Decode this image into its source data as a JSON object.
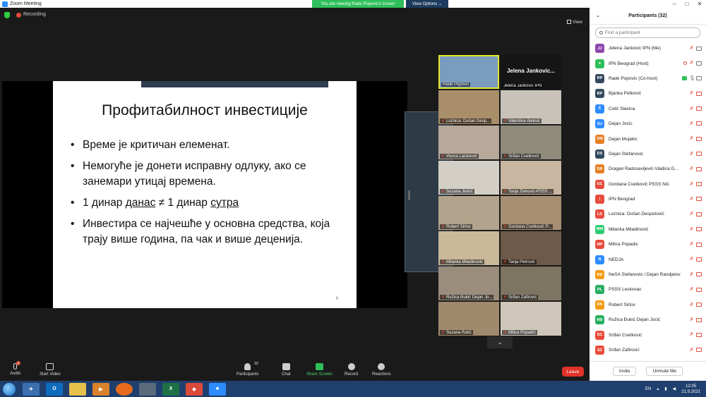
{
  "window": {
    "title": "Zoom Meeting"
  },
  "topbar": {
    "recording_label": "Recording",
    "viewing_banner": "You are viewing Rade Popovic's screen",
    "view_options": "View Options ⌄",
    "view_button": "View"
  },
  "slide": {
    "title": "Профитабилност инвестиције",
    "bullet1": "Време је критичан елеменат.",
    "bullet2": "Немогуће је донети исправну одлуку, ако се занемари утицај времена.",
    "bullet3_a": "1 динар ",
    "bullet3_u1": "данас",
    "bullet3_b": " ≠ 1 динар ",
    "bullet3_u2": "сутра",
    "bullet4": "Инвестира се најчешће у основна средства, која трају више година, па чак и више деценија.",
    "page_number": "9"
  },
  "gallery": {
    "tiles": [
      {
        "name": "Rade Popovic",
        "color": "#7a9cbf"
      },
      {
        "name": "Jelena Jankovic IPN",
        "big": "Jelena Jankovic...",
        "color": "#151515"
      },
      {
        "name": "Loznica: Dušan Desp...",
        "color": "#a98e6a"
      },
      {
        "name": "Valentina Aleksić",
        "color": "#c8c2b8"
      },
      {
        "name": "Vesna Lazarević",
        "color": "#b7a89a"
      },
      {
        "name": "Srđan Cvetković",
        "color": "#8f8a7a"
      },
      {
        "name": "Suzana Jerkić",
        "color": "#d4cfc6"
      },
      {
        "name": "Tanja Živković-PSSS ...",
        "color": "#c9b6a0"
      },
      {
        "name": "Robert Sirtov",
        "color": "#b3a38c"
      },
      {
        "name": "Gordana Cvetković P...",
        "color": "#a88f73"
      },
      {
        "name": "Milanka Miladinović",
        "color": "#c9b89a"
      },
      {
        "name": "Tanja Petrović",
        "color": "#6e5a48"
      },
      {
        "name": "Ružica Đukić Dejan Jo...",
        "color": "#9a8d7c"
      },
      {
        "name": "Srđan Zafirović",
        "color": "#7d7462"
      },
      {
        "name": "Suzana Ratić",
        "color": "#a0896d"
      },
      {
        "name": "Milica Popadić",
        "color": "#cfc7ba"
      }
    ],
    "more": "⌄"
  },
  "participants": {
    "header": "Participants (32)",
    "collapse": "⌄",
    "search_placeholder": "Find a participant",
    "list": [
      {
        "initials": "JJ",
        "name": "Jelena Jankovic IPN (Me)",
        "color": "#8e44ad"
      },
      {
        "initials": "●",
        "name": "IPN Beograd (Host)",
        "color": "#2fbf5a"
      },
      {
        "initials": "RP",
        "name": "Rade Popovic (Co-host)",
        "color": "#34495e"
      },
      {
        "initials": "BP",
        "name": "Bjanka Petković",
        "color": "#34495e"
      },
      {
        "initials": "Č",
        "name": "Čolić Slavica",
        "color": "#2d8cff"
      },
      {
        "initials": "DJ",
        "name": "Dejan Jocic",
        "color": "#2d8cff"
      },
      {
        "initials": "DM",
        "name": "Dejan Mujakic",
        "color": "#e67e22"
      },
      {
        "initials": "DS",
        "name": "Dejan Stefanovic",
        "color": "#34495e"
      },
      {
        "initials": "DR",
        "name": "Dragan Radosavljević-Vladica G...",
        "color": "#e67e22"
      },
      {
        "initials": "GC",
        "name": "Gordana Cvetković PSSS Niš",
        "color": "#e74c3c"
      },
      {
        "initials": "!",
        "name": "IPN Beograd",
        "color": "#e74c3c"
      },
      {
        "initials": "LD",
        "name": "Loznica: Dušan Despotović",
        "color": "#e74c3c"
      },
      {
        "initials": "MM",
        "name": "Milanka Miladinović",
        "color": "#2ecc71"
      },
      {
        "initials": "MP",
        "name": "Milica Popadic",
        "color": "#e74c3c"
      },
      {
        "initials": "N",
        "name": "NEDJA",
        "color": "#2d8cff"
      },
      {
        "initials": "NS",
        "name": "NeŠA Stefanovic i Dejan Randjelovic...",
        "color": "#f39c12"
      },
      {
        "initials": "PL",
        "name": "PSSS Leskovac",
        "color": "#27ae60"
      },
      {
        "initials": "RS",
        "name": "Robert Sirtov",
        "color": "#f39c12"
      },
      {
        "initials": "RĐ",
        "name": "Ružica Đukić Dejan Jocić",
        "color": "#27ae60"
      },
      {
        "initials": "SC",
        "name": "Srđan Cvetković",
        "color": "#e74c3c"
      },
      {
        "initials": "SZ",
        "name": "Srđan Zafirović",
        "color": "#e74c3c"
      }
    ],
    "invite": "Invite",
    "unmute_me": "Unmute Me"
  },
  "toolbar": {
    "audio": "Audio",
    "start_video": "Start Video",
    "participants": "Participants",
    "participants_count": "32",
    "chat": "Chat",
    "share_screen": "Share Screen",
    "record": "Record",
    "reactions": "Reactions",
    "leave": "Leave",
    "mic_badge": "1"
  },
  "taskbar": {
    "lang": "EN",
    "time": "12:05",
    "date": "21.9.2021"
  }
}
